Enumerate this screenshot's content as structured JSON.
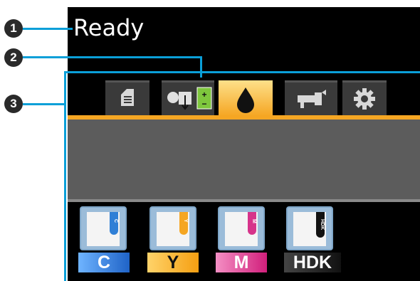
{
  "status_text": "Ready",
  "callouts": [
    "1",
    "2",
    "3"
  ],
  "tabs": [
    {
      "name": "print-queue-tab",
      "icon": "document-icon",
      "active": false
    },
    {
      "name": "media-adjust-tab",
      "icon": "media-feed-adjust-icon",
      "active": false
    },
    {
      "name": "ink-tab",
      "icon": "ink-drop-icon",
      "active": true
    },
    {
      "name": "maintenance-tab",
      "icon": "wrench-icon",
      "active": false
    },
    {
      "name": "settings-tab",
      "icon": "gear-icon",
      "active": false
    }
  ],
  "inks": [
    {
      "code": "C",
      "label": "C",
      "color": "#2f7fd6"
    },
    {
      "code": "Y",
      "label": "Y",
      "color": "#f5a623"
    },
    {
      "code": "M",
      "label": "M",
      "color": "#d6338a"
    },
    {
      "code": "HDK",
      "label": "HDK",
      "color": "#111111"
    }
  ],
  "colors": {
    "accent": "#f5a623",
    "callout_line": "#0a9fd8"
  }
}
